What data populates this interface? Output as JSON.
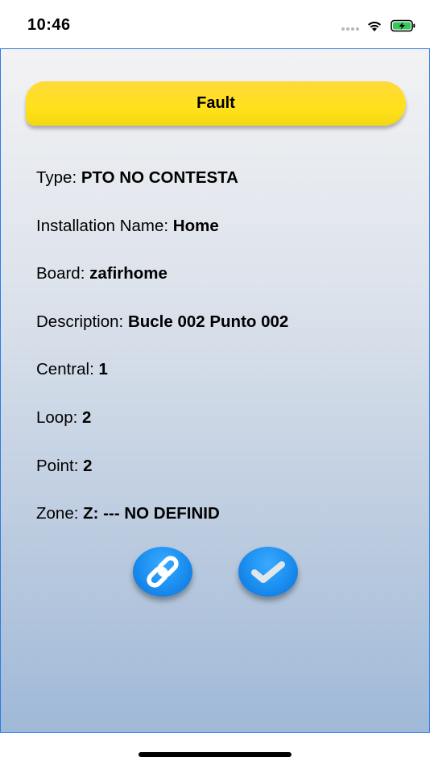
{
  "status_bar": {
    "time": "10:46"
  },
  "header": {
    "title": "Fault"
  },
  "details": [
    {
      "label": "Type: ",
      "value": "PTO NO CONTESTA"
    },
    {
      "label": "Installation Name: ",
      "value": "Home"
    },
    {
      "label": "Board: ",
      "value": "zafirhome"
    },
    {
      "label": "Description: ",
      "value": "Bucle 002 Punto 002"
    },
    {
      "label": "Central: ",
      "value": "1"
    },
    {
      "label": "Loop: ",
      "value": "2"
    },
    {
      "label": "Point: ",
      "value": "2"
    },
    {
      "label": "Zone: ",
      "value": "Z: --- NO DEFINID"
    }
  ],
  "actions": {
    "link_icon": "link-icon",
    "check_icon": "checkmark-icon"
  },
  "colors": {
    "header_yellow": "#ffe21c",
    "button_blue": "#1a8ef0",
    "panel_border": "#2c7be5"
  }
}
